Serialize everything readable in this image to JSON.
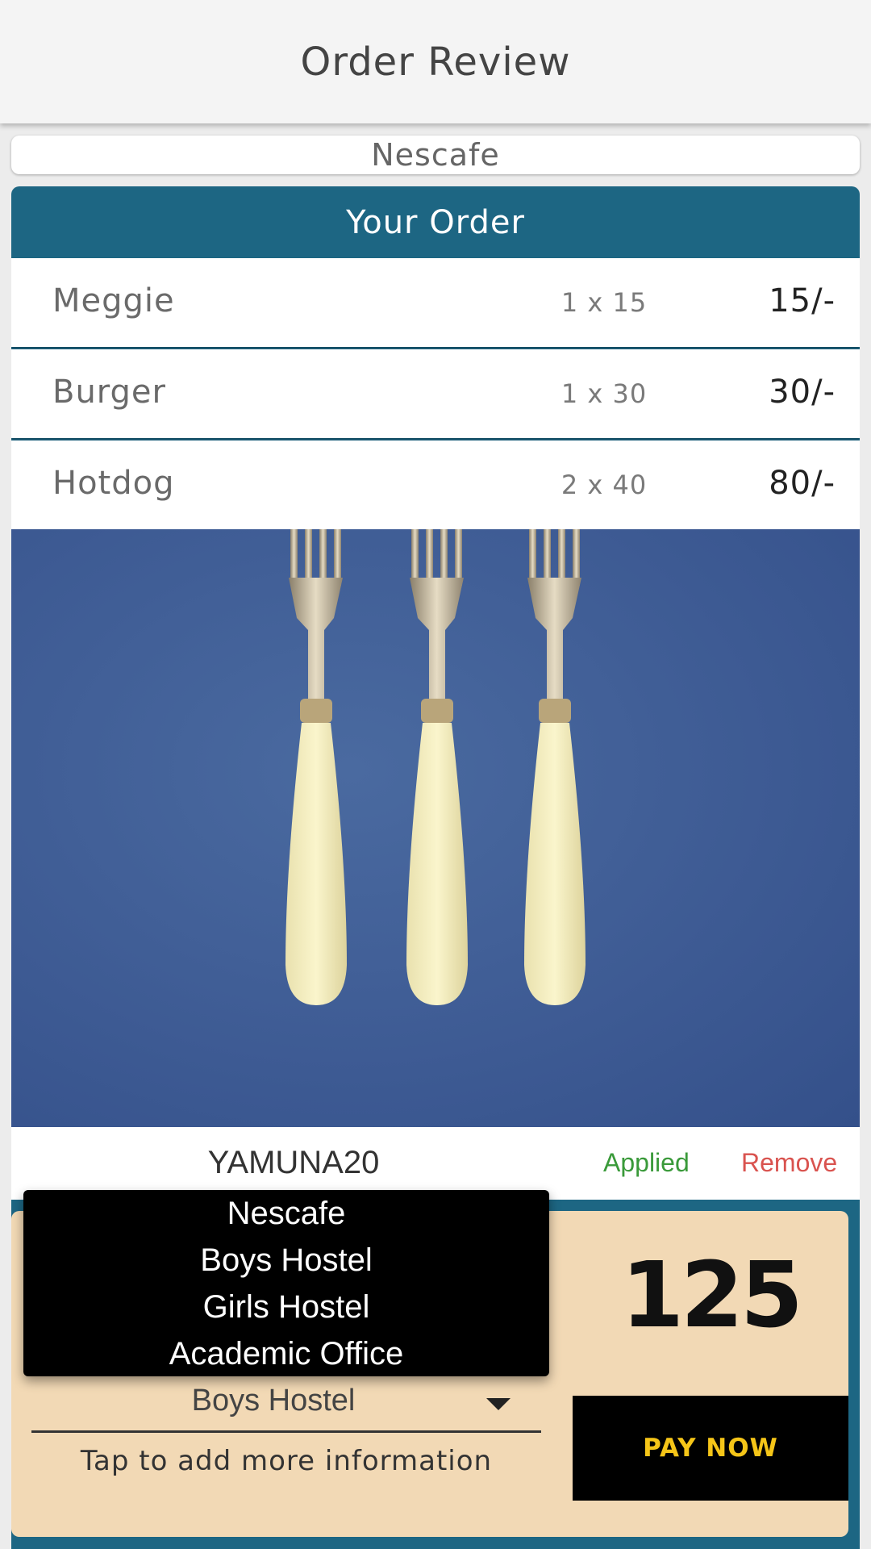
{
  "header": {
    "title": "Order Review"
  },
  "vendor": {
    "name": "Nescafe"
  },
  "order": {
    "heading": "Your Order",
    "items": [
      {
        "name": "Meggie",
        "qty": "1 x 15",
        "price": "15/-"
      },
      {
        "name": "Burger",
        "qty": "1 x 30",
        "price": "30/-"
      },
      {
        "name": "Hotdog",
        "qty": "2 x 40",
        "price": "80/-"
      }
    ]
  },
  "coupon": {
    "code": "YAMUNA20",
    "status": "Applied",
    "remove_label": "Remove"
  },
  "delivery": {
    "selected": "Boys Hostel",
    "options": [
      "Nescafe",
      "Boys Hostel",
      "Girls Hostel",
      "Academic Office"
    ],
    "hint": "Tap to add more information"
  },
  "total": {
    "amount": "125"
  },
  "pay": {
    "label": "PAY NOW"
  },
  "colors": {
    "card_header": "#1d6683",
    "panel": "#f2d9b5",
    "applied": "#3a9a3a",
    "remove": "#d9534f",
    "pay_text": "#f5c518"
  }
}
